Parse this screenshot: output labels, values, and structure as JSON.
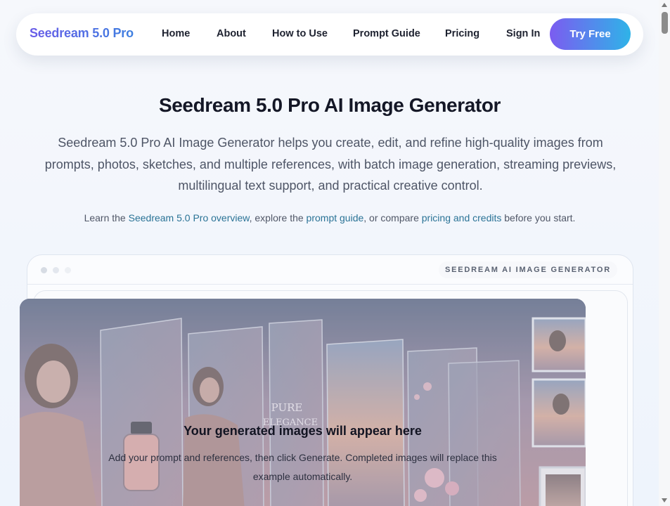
{
  "nav": {
    "brand": "Seedream 5.0 Pro",
    "links": [
      "Home",
      "About",
      "How to Use",
      "Prompt Guide",
      "Pricing",
      "Sign In"
    ],
    "cta": "Try Free"
  },
  "hero": {
    "title": "Seedream 5.0 Pro AI Image Generator",
    "description": "Seedream 5.0 Pro AI Image Generator helps you create, edit, and refine high-quality images from prompts, photos, sketches, and multiple references, with batch image generation, streaming previews, multilingual text support, and practical creative control.",
    "links_line": {
      "prefix": "Learn the ",
      "link1": "Seedream 5.0 Pro overview",
      "mid1": ", explore the ",
      "link2": "prompt guide",
      "mid2": ", or compare ",
      "link3": "pricing and credits",
      "suffix": " before you start."
    }
  },
  "generator": {
    "label": "SEEDREAM AI IMAGE GENERATOR",
    "placeholder_title": "Your generated images will appear here",
    "placeholder_desc": "Add your prompt and references, then click Generate. Completed images will replace this example automatically.",
    "poster_text": [
      "PURE",
      "ELEGANCE"
    ]
  },
  "colors": {
    "accent_start": "#7b5cf0",
    "accent_end": "#2fb3e8",
    "link": "#2a7396"
  }
}
